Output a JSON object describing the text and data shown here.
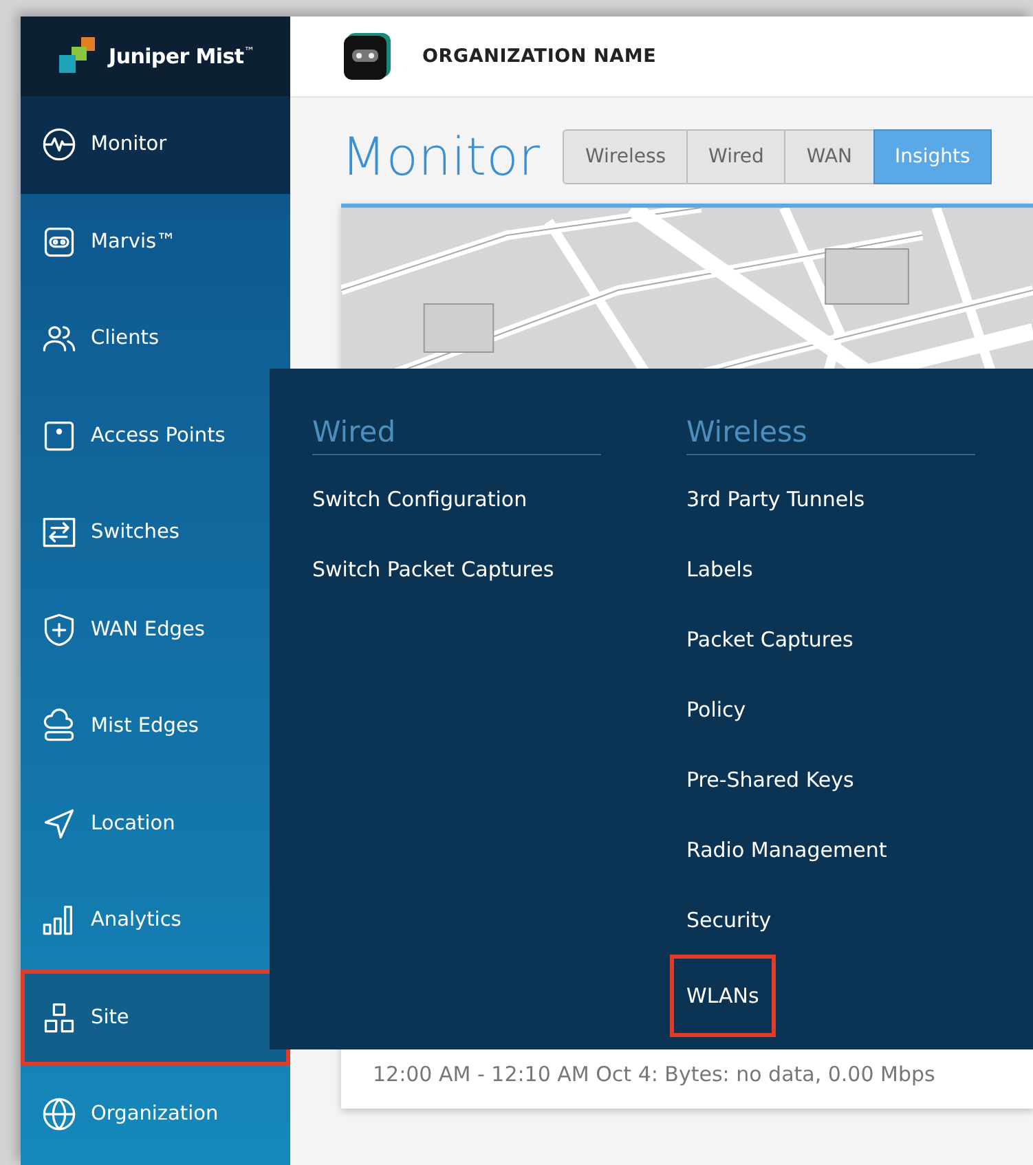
{
  "logo": {
    "text": "Juniper Mist$^{™}$"
  },
  "org": {
    "name": "ORGANIZATION NAME"
  },
  "sidebar": {
    "items": [
      {
        "label": "Monitor",
        "selected": true,
        "expanded": false,
        "annotated": false
      },
      {
        "label": "Marvis™",
        "selected": false,
        "expanded": false,
        "annotated": false
      },
      {
        "label": "Clients",
        "selected": false,
        "expanded": false,
        "annotated": false
      },
      {
        "label": "Access Points",
        "selected": false,
        "expanded": false,
        "annotated": false
      },
      {
        "label": "Switches",
        "selected": false,
        "expanded": false,
        "annotated": false
      },
      {
        "label": "WAN Edges",
        "selected": false,
        "expanded": false,
        "annotated": false
      },
      {
        "label": "Mist Edges",
        "selected": false,
        "expanded": false,
        "annotated": false
      },
      {
        "label": "Location",
        "selected": false,
        "expanded": false,
        "annotated": false
      },
      {
        "label": "Analytics",
        "selected": false,
        "expanded": false,
        "annotated": false
      },
      {
        "label": "Site",
        "selected": false,
        "expanded": true,
        "annotated": true
      },
      {
        "label": "Organization",
        "selected": false,
        "expanded": false,
        "annotated": false
      }
    ]
  },
  "page": {
    "title": "Monitor",
    "tabs": [
      {
        "label": "Wireless",
        "selected": false
      },
      {
        "label": "Wired",
        "selected": false
      },
      {
        "label": "WAN",
        "selected": false
      },
      {
        "label": "Insights",
        "selected": true
      }
    ],
    "footer": "12:00 AM - 12:10 AM Oct 4: Bytes: no data, 0.00 Mbps"
  },
  "flyout": {
    "columns": [
      {
        "heading": "Wired",
        "items": [
          {
            "label": "Switch Configuration",
            "annotated": false
          },
          {
            "label": "Switch Packet Captures",
            "annotated": false
          }
        ]
      },
      {
        "heading": "Wireless",
        "items": [
          {
            "label": "3rd Party Tunnels",
            "annotated": false
          },
          {
            "label": "Labels",
            "annotated": false
          },
          {
            "label": "Packet Captures",
            "annotated": false
          },
          {
            "label": "Policy",
            "annotated": false
          },
          {
            "label": "Pre-Shared Keys",
            "annotated": false
          },
          {
            "label": "Radio Management",
            "annotated": false
          },
          {
            "label": "Security",
            "annotated": false
          },
          {
            "label": "WLANs",
            "annotated": true
          }
        ]
      }
    ]
  }
}
